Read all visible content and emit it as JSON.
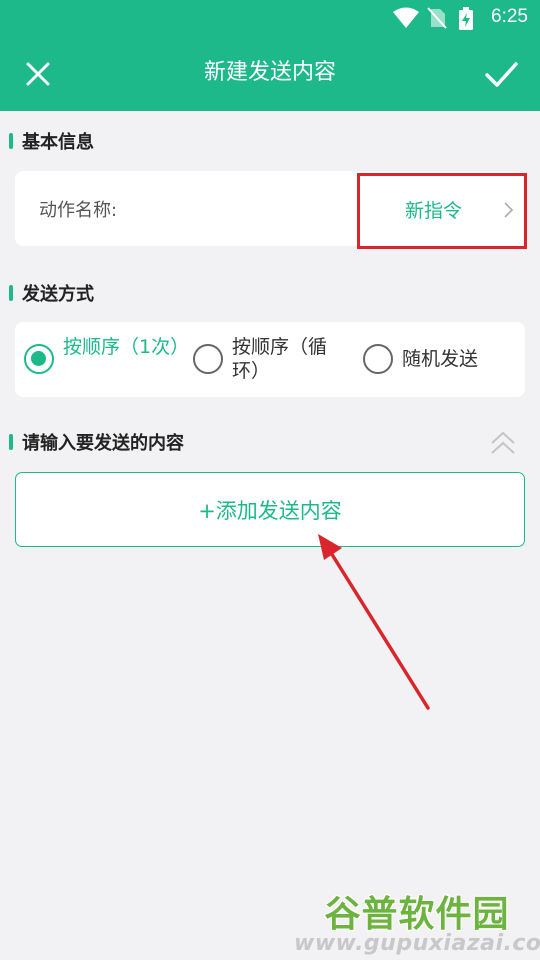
{
  "status_bar": {
    "time": "6:25"
  },
  "header": {
    "title": "新建发送内容",
    "close_icon": "close-icon",
    "confirm_icon": "check-icon"
  },
  "basic_info": {
    "section_title": "基本信息",
    "name_label": "动作名称:",
    "name_value": "新指令"
  },
  "send_method": {
    "section_title": "发送方式",
    "options": [
      {
        "label": "按顺序（1次）",
        "selected": true
      },
      {
        "label": "按顺序（循环）",
        "selected": false
      },
      {
        "label": "随机发送",
        "selected": false
      }
    ]
  },
  "content": {
    "section_title": "请输入要发送的内容",
    "add_button_label": "+添加发送内容"
  },
  "watermark": {
    "main": "谷普软件园",
    "sub": "www.gupuxiazai.com"
  },
  "colors": {
    "accent": "#1db98a",
    "annotation": "#d9252b",
    "background": "#f2f2f4"
  }
}
